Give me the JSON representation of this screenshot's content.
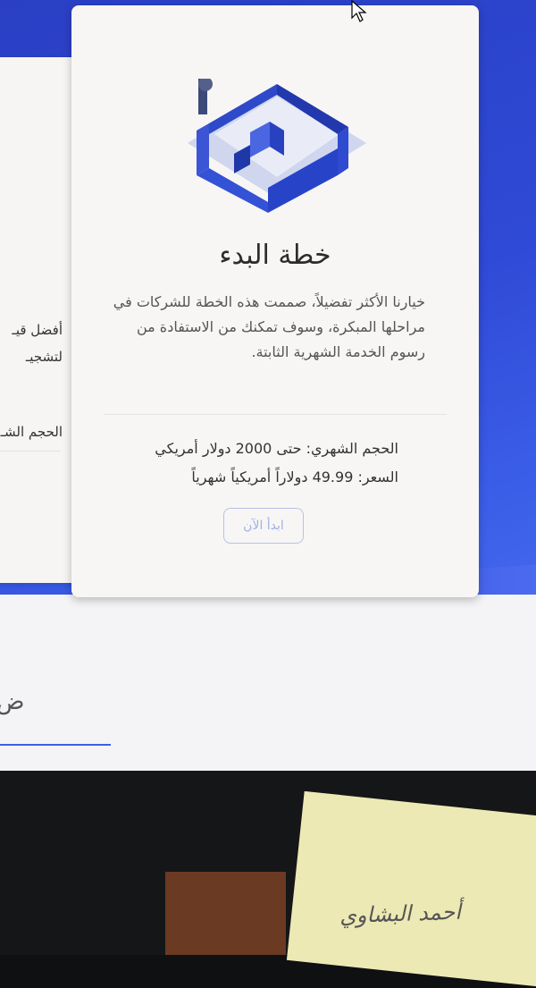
{
  "main_card": {
    "title": "خطة البدء",
    "description": "خيارنا الأكثر تفضيلاً، صممت هذه الخطة للشركات في مراحلها المبكرة، وسوف تمكنك من الاستفادة من رسوم الخدمة الشهرية الثابتة.",
    "monthly_volume": "الحجم الشهري: حتى 2000 دولار أمريكي",
    "price": "السعر: 49.99 دولاراً أمريكياً شهرياً",
    "start_button": "ابدأ الآن"
  },
  "left_card": {
    "line1": "أفضل قيـ",
    "line2": "لتشجيـ",
    "line3": "الحجم الشـ"
  },
  "input_glyph": "ض",
  "sticky_note_text": "أحمد البشاوي",
  "colors": {
    "screen_blue": "#2f4ad6",
    "card_bg": "#f7f6f4",
    "button_border": "#b9c2e8",
    "illustration_blue": "#2e49c9"
  }
}
